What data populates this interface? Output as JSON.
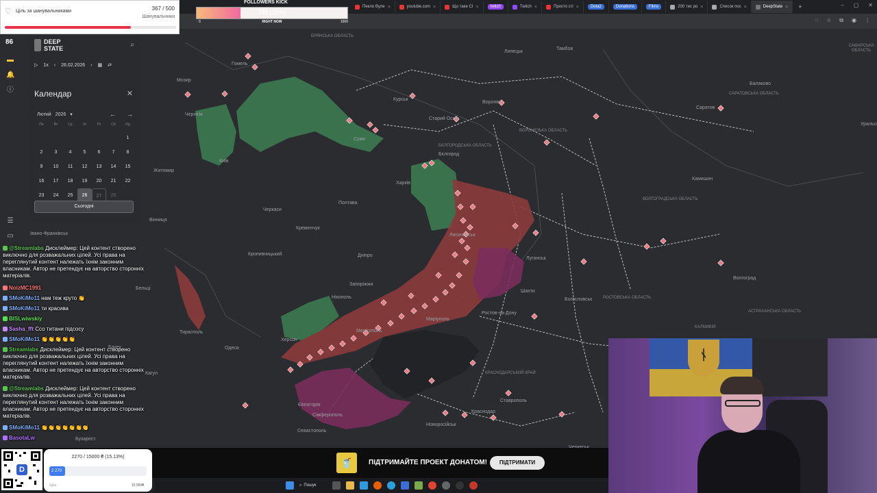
{
  "browser": {
    "tabs": [
      {
        "label": "Пекло Вуле",
        "color": "#e33"
      },
      {
        "label": "youtube.com",
        "color": "#e33"
      },
      {
        "label": "Що таке CI",
        "color": "#e33"
      },
      {
        "label": "twitch",
        "color": "#9146ff",
        "pill": true
      },
      {
        "label": "Twitch",
        "color": "#9146ff"
      },
      {
        "label": "Просто сті",
        "color": "#e33"
      },
      {
        "label": "Dota2",
        "color": "#3a6fd8",
        "pill": true
      },
      {
        "label": "Donations",
        "color": "#3a6fd8",
        "pill": true
      },
      {
        "label": "Films",
        "color": "#3a6fd8",
        "pill": true
      },
      {
        "label": "200 тис ро",
        "color": "#aaa"
      },
      {
        "label": "Список пос",
        "color": "#aaa"
      },
      {
        "label": "DeepState",
        "color": "#777",
        "active": true
      }
    ],
    "new_tab": "+",
    "window_controls": [
      "–",
      "▢",
      "✕"
    ]
  },
  "goal_widget": {
    "title": "Ціль за шанувальниками",
    "count": "367 / 500",
    "unit": "Шанувальники",
    "progress": 0.734
  },
  "followers_kick": {
    "label": "FOLLOWERS KICK",
    "value": "289 (28%)",
    "progress": 0.289,
    "min": "0",
    "center": "RIGHT NOW",
    "max": "1000"
  },
  "rail": {
    "counter": "86",
    "icons": [
      "flag-icon",
      "bell-icon",
      "info-icon",
      "sliders-icon",
      "keyboard-icon"
    ]
  },
  "sidebar": {
    "brand_line1": "DEEP",
    "brand_line2": "STATE",
    "speed": "1x",
    "date": "26.02.2026",
    "calendar_title": "Календар",
    "month": "Лютий",
    "year": "2026",
    "weekdays": [
      "Пн",
      "Вт",
      "Ср",
      "Чт",
      "Пт",
      "Сб",
      "Нд"
    ],
    "today_button": "Сьогодні"
  },
  "map": {
    "cities": [
      {
        "name": "Гомель"
      },
      {
        "name": "Мозир"
      },
      {
        "name": "Чернігів"
      },
      {
        "name": "Київ"
      },
      {
        "name": "Житомир"
      },
      {
        "name": "Суми"
      },
      {
        "name": "Курськ"
      },
      {
        "name": "Старий Оскіл"
      },
      {
        "name": "Бєлгород"
      },
      {
        "name": "Воронеж"
      },
      {
        "name": "Тамбов"
      },
      {
        "name": "Липецьк"
      },
      {
        "name": "Балаково"
      },
      {
        "name": "Саратов"
      },
      {
        "name": "Харків"
      },
      {
        "name": "Полтава"
      },
      {
        "name": "Черкаси"
      },
      {
        "name": "Кременчук"
      },
      {
        "name": "Вінниця"
      },
      {
        "name": "Кропивницький"
      },
      {
        "name": "Дніпро"
      },
      {
        "name": "Запоріжжя"
      },
      {
        "name": "Нікополь"
      },
      {
        "name": "Маріуполь"
      },
      {
        "name": "Мелітополь"
      },
      {
        "name": "Херсон"
      },
      {
        "name": "Одеса"
      },
      {
        "name": "Бельці"
      },
      {
        "name": "Тирасполь"
      },
      {
        "name": "Кагул"
      },
      {
        "name": "Бакеу"
      },
      {
        "name": "Бухарест"
      },
      {
        "name": "Євпаторія"
      },
      {
        "name": "Сімферополь"
      },
      {
        "name": "Севастополь"
      },
      {
        "name": "Новоросійськ"
      },
      {
        "name": "Краснодар"
      },
      {
        "name": "Ставрополь"
      },
      {
        "name": "Ростов-на-Дону"
      },
      {
        "name": "Шахти"
      },
      {
        "name": "Камишин"
      },
      {
        "name": "Волгоград"
      },
      {
        "name": "Уральськ"
      },
      {
        "name": "Лисичанськ"
      },
      {
        "name": "Луганськ"
      },
      {
        "name": "Богословськ"
      },
      {
        "name": "Іванo-Франківськ"
      },
      {
        "name": "Черкеськ"
      }
    ],
    "regions": [
      {
        "name": "БРЯНСЬКА ОБЛАСТЬ"
      },
      {
        "name": "БЄЛГОРОДСЬКА ОБЛАСТЬ"
      },
      {
        "name": "ВОРОНЕЗЬКА ОБЛАСТЬ"
      },
      {
        "name": "САРАТОВСЬКА ОБЛАСТЬ"
      },
      {
        "name": "ВОЛГОГРАДСЬКА ОБЛАСТЬ"
      },
      {
        "name": "АСТРАХАНСЬКА ОБЛАСТЬ"
      },
      {
        "name": "САМАРСЬКА ОБЛАСТЬ"
      },
      {
        "name": "КАЛМИКІЯ"
      },
      {
        "name": "КРАСНОДАРСЬКИЙ КРАЙ"
      },
      {
        "name": "РОСТОВСЬКА ОБЛАСТЬ"
      }
    ]
  },
  "chat": [
    {
      "user": "@Streamlabs",
      "color": "#59c44f",
      "text": "Дисклеймер: Цей контент створено виключно для розважальних цілей. Усі права на переглянутий контент належать їхнім законним власникам. Автор не претендує на авторство сторонніх матеріалів."
    },
    {
      "user": "NoizMC1991",
      "color": "#ff7777",
      "text": ""
    },
    {
      "user": "SMoKiMo11",
      "color": "#7fb0ff",
      "text": "нам теж круто 👏"
    },
    {
      "user": "SMoKiMo11",
      "color": "#7fb0ff",
      "text": "ти красива"
    },
    {
      "user": "BISLwiwskiy",
      "color": "#59e04f",
      "text": ""
    },
    {
      "user": "Sasha_fft",
      "color": "#c58cff",
      "text": "Ссо титани підсосу"
    },
    {
      "user": "SMoKiMo11",
      "color": "#7fb0ff",
      "text": "👏👏👏👏👏"
    },
    {
      "user": "Streamlabs",
      "color": "#59c44f",
      "text": "Дисклеймер: Цей контент створено виключно для розважальних цілей. Усі права на переглянутий контент належать їхнім законним власникам. Автор не претендує на авторство сторонніх матеріалів."
    },
    {
      "user": "@Streamlabs",
      "color": "#59c44f",
      "text": "Дисклеймер: Цей контент створено виключно для розважальних цілей. Усі права на переглянутий контент належать їхнім законним власникам. Автор не претендує на авторство сторонніх матеріалів."
    },
    {
      "user": "SMoKiMo11",
      "color": "#7fb0ff",
      "text": "👏👏👏👏👏👏👏"
    },
    {
      "user": "BasotaLw",
      "color": "#b070ff",
      "text": ""
    }
  ],
  "banner": {
    "text": "ПІДТРИМАЙТЕ ПРОЕКТ ДОНАТОМ!",
    "button": "ПІДТРИМАТИ"
  },
  "mono_widget": {
    "title": "2270 / 15000 ₴ (15.13%)",
    "fill_label": "2 270",
    "progress": 0.1513,
    "left_label": "Ціль",
    "right_label": "15 000₴"
  },
  "taskbar": {
    "search": "Пошук"
  },
  "colors": {
    "occupied": "#8b3b3b",
    "occupied_crimea": "#7a2e5c",
    "liberated": "#3d7a52",
    "attack_marker": "#e87d86"
  }
}
